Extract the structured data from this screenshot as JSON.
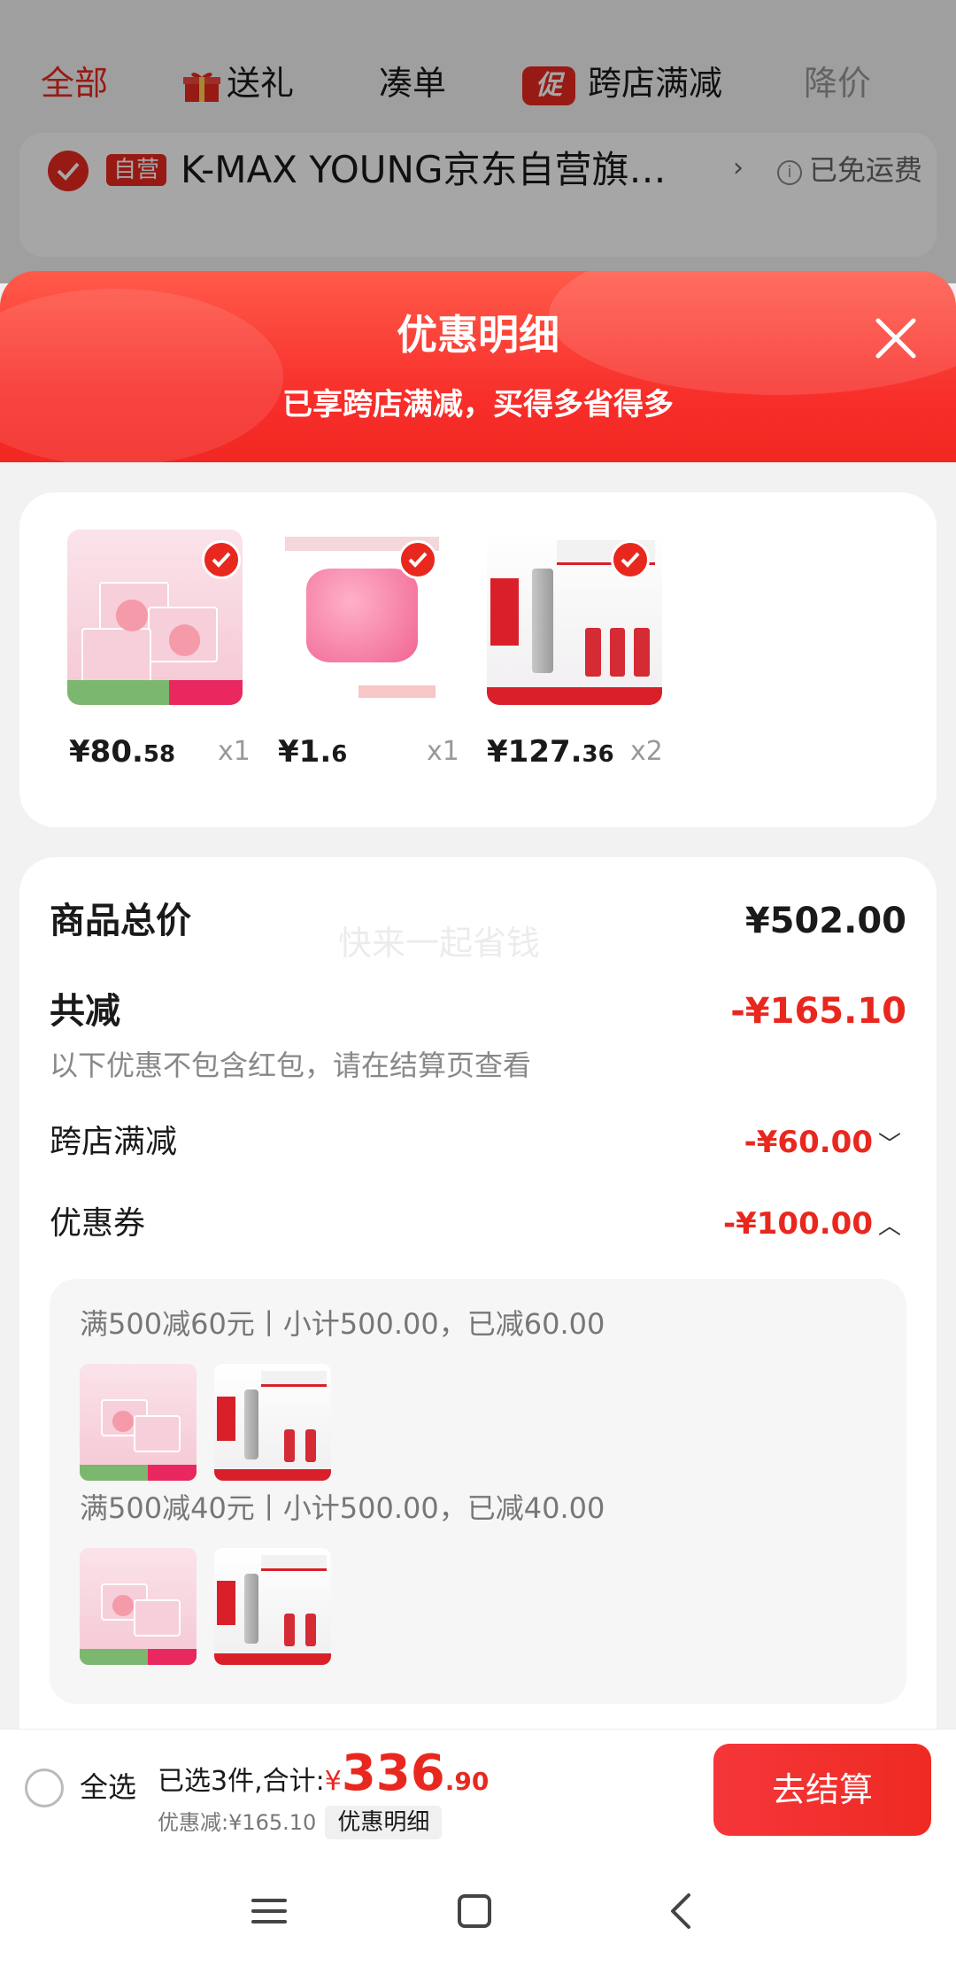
{
  "tabs": [
    {
      "label": "全部",
      "state": "active"
    },
    {
      "label": "送礼",
      "icon": "gift-icon"
    },
    {
      "label": "凑单"
    },
    {
      "label": "跨店满减",
      "icon_text": "促"
    },
    {
      "label": "降价",
      "state": "muted"
    }
  ],
  "shop": {
    "badge": "自营",
    "name": "K-MAX YOUNG京东自营旗…",
    "arrow": "›",
    "shipping": "已免运费"
  },
  "sheet": {
    "title": "优惠明细",
    "subtitle": "已享跨店满减，买得多省得多"
  },
  "products": [
    {
      "price_int": "¥80.",
      "price_dec": "58",
      "qty": "x1",
      "art": "mask"
    },
    {
      "price_int": "¥1.",
      "price_dec": "6",
      "qty": "x1",
      "art": "soap"
    },
    {
      "price_int": "¥127.",
      "price_dec": "36",
      "qty": "x2",
      "art": "proya"
    }
  ],
  "summary": {
    "watermark": "快来一起省钱",
    "total_label": "商品总价",
    "total_value": "¥502.00",
    "discount_label": "共减",
    "discount_value": "-¥165.10",
    "discount_note": "以下优惠不包含红包，请在结算页查看",
    "cross_store_label": "跨店满减",
    "cross_store_value": "-¥60.00",
    "coupon_label": "优惠券",
    "coupon_value": "-¥100.00"
  },
  "coupons": [
    {
      "title": "满500减60元丨小计500.00，已减60.00"
    },
    {
      "title": "满500减40元丨小计500.00，已减40.00"
    }
  ],
  "checkout": {
    "select_all": "全选",
    "selected_text": "已选3件,合计:",
    "currency": "¥",
    "total_int": "336",
    "total_dec": ".90",
    "saved_text": "优惠减:¥165.10",
    "detail_chip": "优惠明细",
    "button": "去结算"
  },
  "colors": {
    "accent": "#e8281f"
  }
}
